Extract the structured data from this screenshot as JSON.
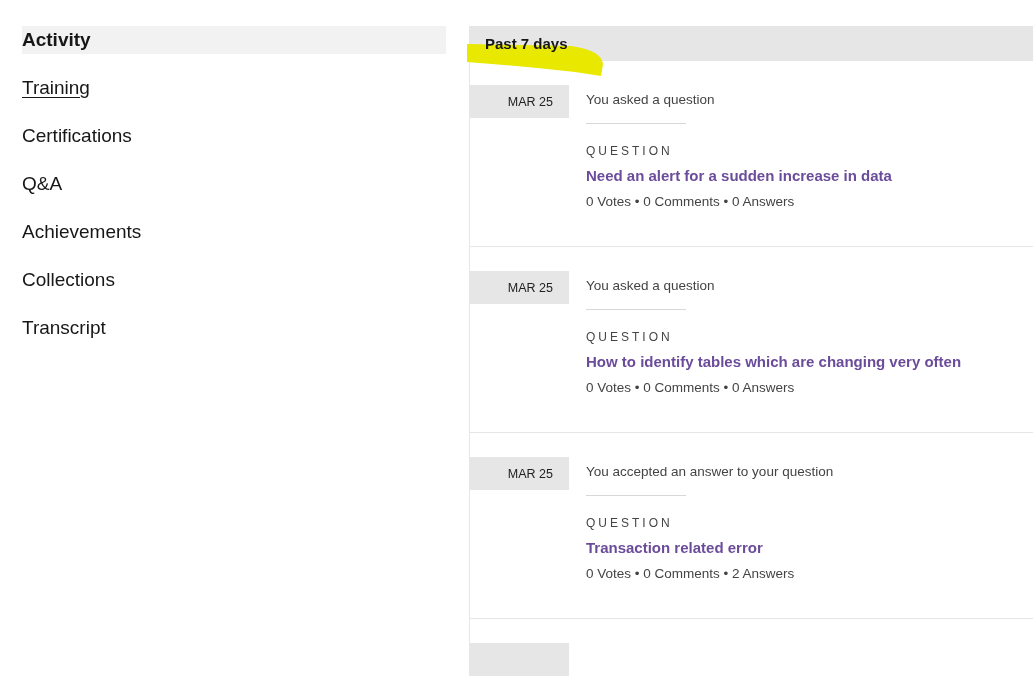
{
  "sidebar": {
    "items": [
      {
        "label": "Activity",
        "selected": true,
        "underlined": false
      },
      {
        "label": "Training",
        "selected": false,
        "underlined": true
      },
      {
        "label": "Certifications",
        "selected": false,
        "underlined": false
      },
      {
        "label": "Q&A",
        "selected": false,
        "underlined": false
      },
      {
        "label": "Achievements",
        "selected": false,
        "underlined": false
      },
      {
        "label": "Collections",
        "selected": false,
        "underlined": false
      },
      {
        "label": "Transcript",
        "selected": false,
        "underlined": false
      }
    ]
  },
  "feed": {
    "period": "Past 7 days",
    "highlighted": true,
    "entries": [
      {
        "date": "MAR 25",
        "action": "You asked a question",
        "type": "QUESTION",
        "title": "Need an alert for a sudden increase in data",
        "stats": "0 Votes • 0 Comments • 0 Answers"
      },
      {
        "date": "MAR 25",
        "action": "You asked a question",
        "type": "QUESTION",
        "title": "How to identify tables which are changing very often",
        "stats": "0 Votes • 0 Comments • 0 Answers"
      },
      {
        "date": "MAR 25",
        "action": "You accepted an answer to your question",
        "type": "QUESTION",
        "title": "Transaction related error",
        "stats": "0 Votes • 0 Comments • 2 Answers"
      }
    ]
  }
}
